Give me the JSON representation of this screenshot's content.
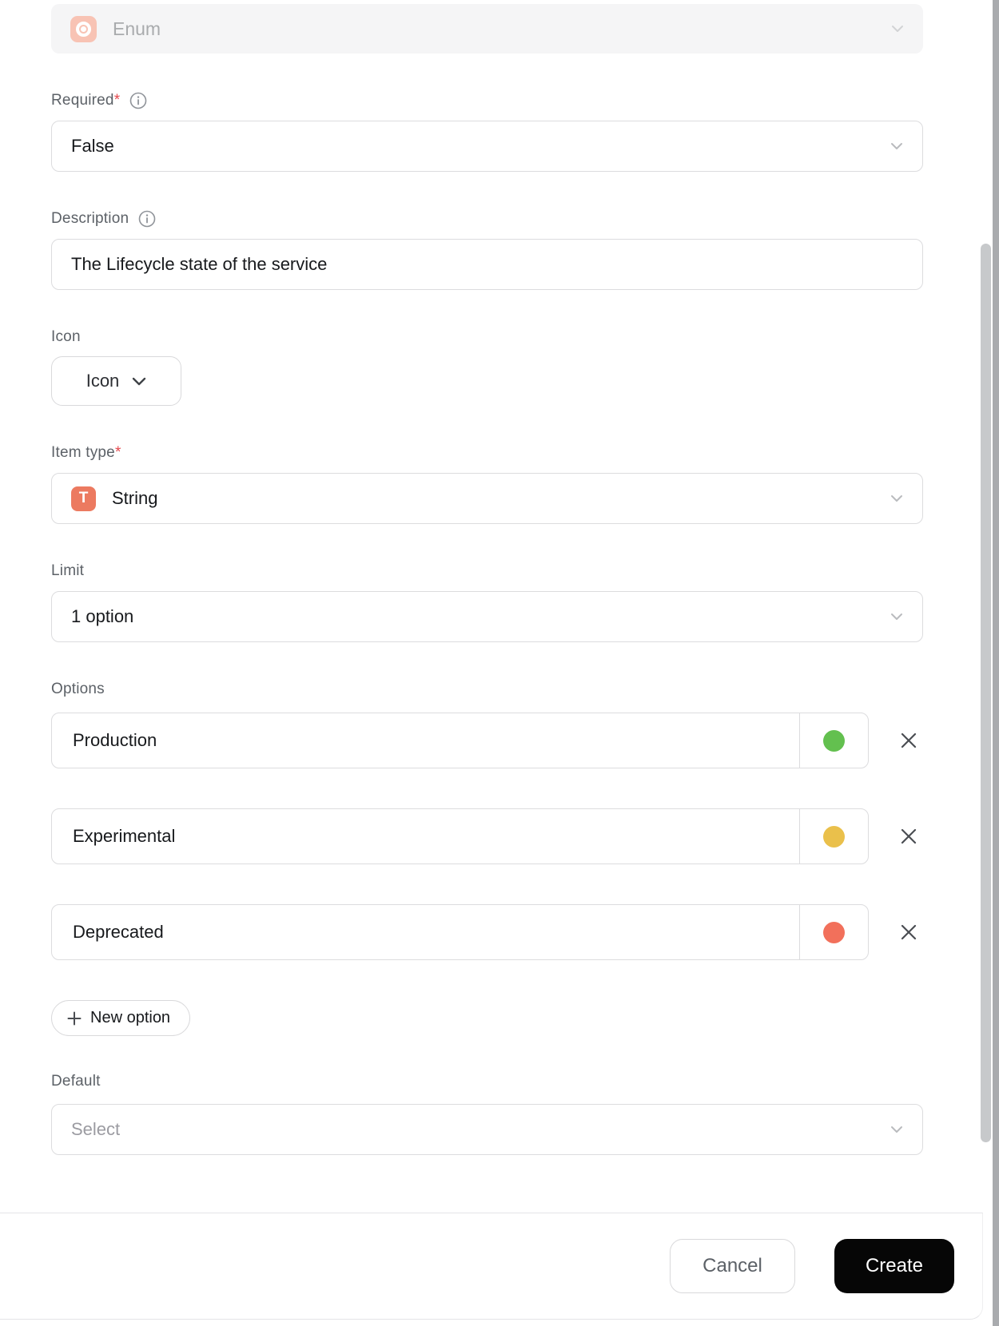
{
  "type_select": {
    "value": "Enum",
    "icon": "enum-icon"
  },
  "required": {
    "label": "Required",
    "required_mark": "*",
    "value": "False"
  },
  "description": {
    "label": "Description",
    "value": "The Lifecycle state of the service"
  },
  "icon_field": {
    "label": "Icon",
    "button_label": "Icon"
  },
  "item_type": {
    "label": "Item type",
    "required_mark": "*",
    "value": "String",
    "type_letter": "T"
  },
  "limit": {
    "label": "Limit",
    "value": "1 option"
  },
  "options": {
    "label": "Options",
    "items": [
      {
        "value": "Production",
        "color": "#63c04f"
      },
      {
        "value": "Experimental",
        "color": "#eac04b"
      },
      {
        "value": "Deprecated",
        "color": "#f2705b"
      }
    ],
    "new_option_label": "New option"
  },
  "default_field": {
    "label": "Default",
    "placeholder": "Select"
  },
  "footer": {
    "cancel_label": "Cancel",
    "create_label": "Create"
  },
  "colors": {
    "accent_coral": "#ec7a60",
    "enum_icon_bg": "#f8c3b4",
    "green": "#63c04f",
    "yellow": "#eac04b",
    "red": "#f2705b",
    "create_button_bg": "#060606"
  }
}
